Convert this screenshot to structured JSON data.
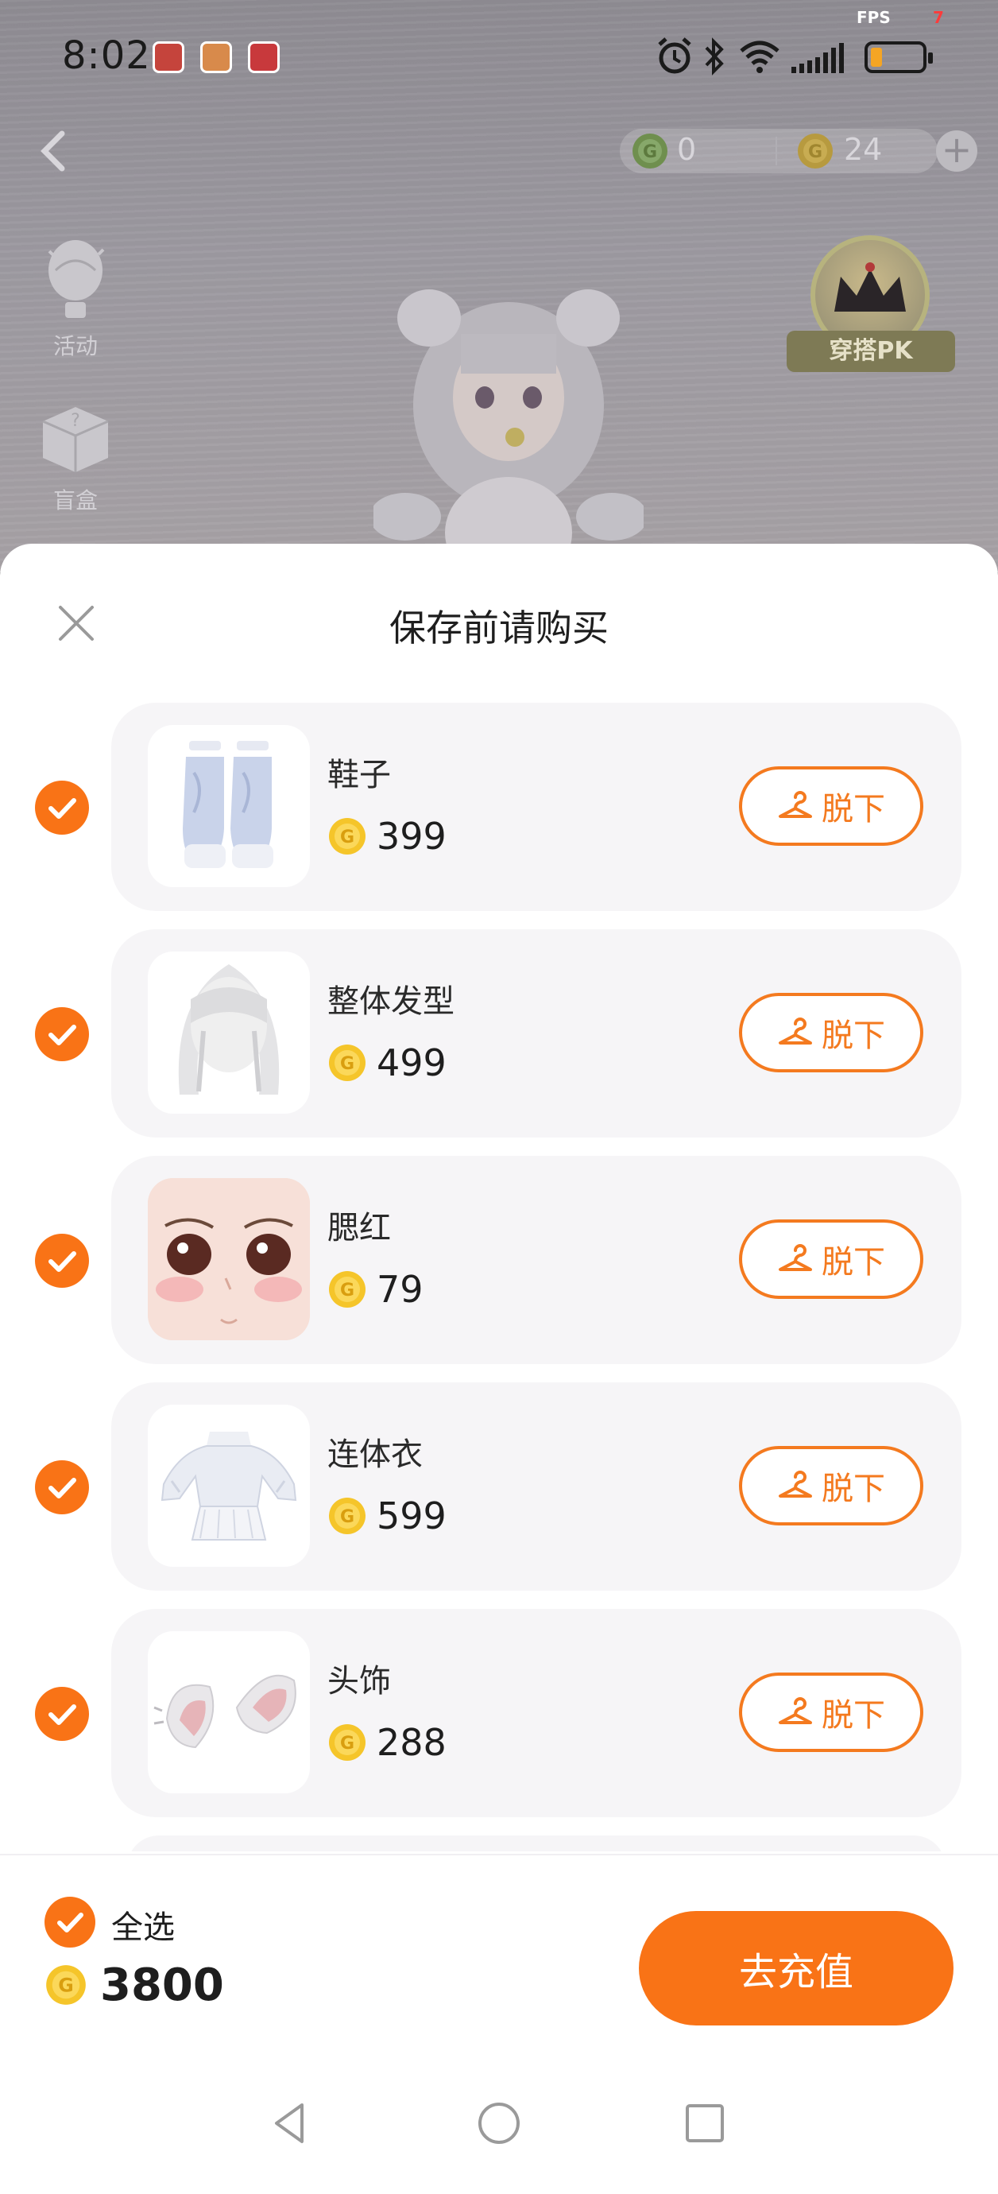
{
  "status_bar": {
    "time": "8:02",
    "fps_label": "FPS",
    "fps_value": "7",
    "notification_colors": [
      "#e2463b",
      "#f08a3c",
      "#e5383b"
    ]
  },
  "game_header": {
    "green_currency": "0",
    "gold_currency": "24"
  },
  "side_menu": [
    {
      "label": "活动",
      "icon": "balloon-icon"
    },
    {
      "label": "盲盒",
      "icon": "mystery-box-icon"
    }
  ],
  "pk_badge": {
    "label": "穿搭PK"
  },
  "sheet": {
    "title": "保存前请购买",
    "remove_label": "脱下",
    "items": [
      {
        "name": "鞋子",
        "price": "399",
        "checked": true,
        "thumb": "shoes"
      },
      {
        "name": "整体发型",
        "price": "499",
        "checked": true,
        "thumb": "hair"
      },
      {
        "name": "腮红",
        "price": "79",
        "checked": true,
        "thumb": "face"
      },
      {
        "name": "连体衣",
        "price": "599",
        "checked": true,
        "thumb": "outfit"
      },
      {
        "name": "头饰",
        "price": "288",
        "checked": true,
        "thumb": "ears"
      }
    ]
  },
  "footer": {
    "select_all_label": "全选",
    "total": "3800",
    "recharge_label": "去充值"
  },
  "colors": {
    "accent": "#f97316",
    "coin": "#f2b81a",
    "green_coin": "#5aa637"
  }
}
